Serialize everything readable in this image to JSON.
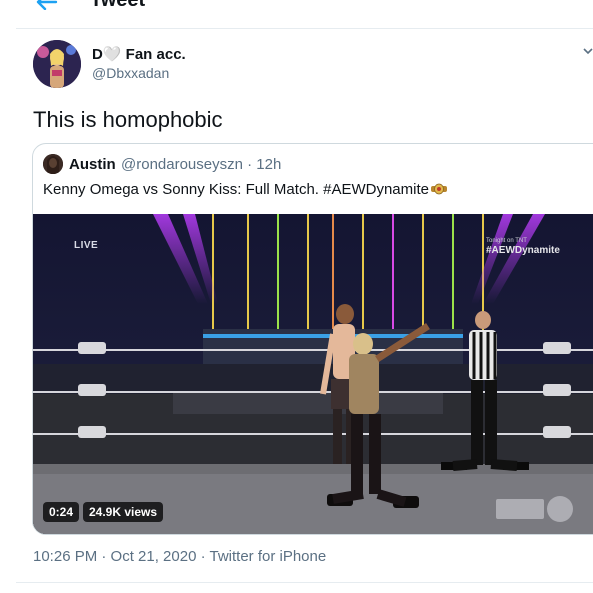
{
  "header": {
    "title": "Tweet",
    "back_icon": "arrow-left-icon",
    "accent": "#1da1f2"
  },
  "tweet": {
    "display_name": "D🤍 Fan acc.",
    "handle": "@Dbxxadan",
    "text": "This is homophobic",
    "timestamp": "10:26 PM · Oct 21, 2020 · Twitter for iPhone"
  },
  "quote": {
    "name": "Austin",
    "handle_time": "@rondarouseyszn · 12h",
    "text": "Kenny Omega vs Sonny Kiss: Full Match. #AEWDynamite",
    "emoji_icon": "championship-belt-icon"
  },
  "video": {
    "duration": "0:24",
    "views": "24.9K views",
    "live_label": "LIVE",
    "brand_small": "Tonight on TNT",
    "brand_label": "#AEWDynamite"
  }
}
